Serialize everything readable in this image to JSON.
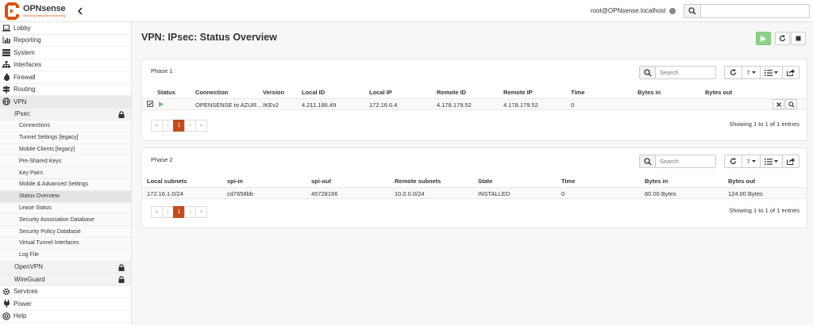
{
  "header": {
    "brand": "OPNsense",
    "tagline": "Securing networks made easy",
    "user": "root@OPNsense.localhost",
    "search_placeholder": ""
  },
  "colors": {
    "accent": "#c84a1b",
    "logo": "#d94f00",
    "play": "#8fd18a"
  },
  "sidebar": {
    "top_items": [
      {
        "label": "Lobby",
        "icon": "laptop-icon"
      },
      {
        "label": "Reporting",
        "icon": "chart-icon"
      },
      {
        "label": "System",
        "icon": "server-icon"
      },
      {
        "label": "Interfaces",
        "icon": "sitemap-icon"
      },
      {
        "label": "Firewall",
        "icon": "fire-icon"
      },
      {
        "label": "Routing",
        "icon": "signpost-icon"
      }
    ],
    "vpn_label": "VPN",
    "ipsec_label": "IPsec",
    "ipsec_items": [
      "Connections",
      "Tunnel Settings [legacy]",
      "Mobile Clients [legacy]",
      "Pre-Shared Keys",
      "Key Pairs",
      "Mobile & Advanced Settings",
      "Status Overview",
      "Lease Status",
      "Security Association Database",
      "Security Policy Database",
      "Virtual Tunnel Interfaces",
      "Log File"
    ],
    "openvpn_label": "OpenVPN",
    "wireguard_label": "WireGuard",
    "bottom_items": [
      {
        "label": "Services",
        "icon": "cog-icon"
      },
      {
        "label": "Power",
        "icon": "plug-icon"
      },
      {
        "label": "Help",
        "icon": "lifebuoy-icon"
      }
    ]
  },
  "main": {
    "title": "VPN: IPsec: Status Overview"
  },
  "phase1": {
    "title": "Phase 1",
    "search_placeholder": "Search",
    "page_size": "7",
    "columns": [
      "Status",
      "Connection",
      "Version",
      "Local ID",
      "Local IP",
      "Remote ID",
      "Remote IP",
      "Time",
      "Bytes in",
      "Bytes out"
    ],
    "rows": [
      {
        "connection": "OPENSENSE to AZUR...",
        "version": "IKEv2",
        "local_id": "4.211.186.49",
        "local_ip": "172.16.0.4",
        "remote_id": "4.178.179.52",
        "remote_ip": "4.178.179.52",
        "time": "0",
        "bytes_in": "",
        "bytes_out": ""
      }
    ],
    "pager": {
      "first": "«",
      "prev": "‹",
      "current": "1",
      "next": "›",
      "last": "»"
    },
    "showing": "Showing 1 to 1 of 1 entries"
  },
  "phase2": {
    "title": "Phase 2",
    "search_placeholder": "Search",
    "page_size": "7",
    "columns": [
      "Local subnets",
      "spi-in",
      "spi-out",
      "Remote subnets",
      "State",
      "Time",
      "Bytes in",
      "Bytes out"
    ],
    "rows": [
      {
        "local_subnets": "172.16.1.0/24",
        "spi_in": "cd7658bb",
        "spi_out": "45728166",
        "remote_subnets": "10.0.0.0/24",
        "state": "INSTALLED",
        "time": "0",
        "bytes_in": "60.00 Bytes",
        "bytes_out": "124.00 Bytes"
      }
    ],
    "pager": {
      "first": "«",
      "prev": "‹",
      "current": "1",
      "next": "›",
      "last": "»"
    },
    "showing": "Showing 1 to 1 of 1 entries"
  }
}
